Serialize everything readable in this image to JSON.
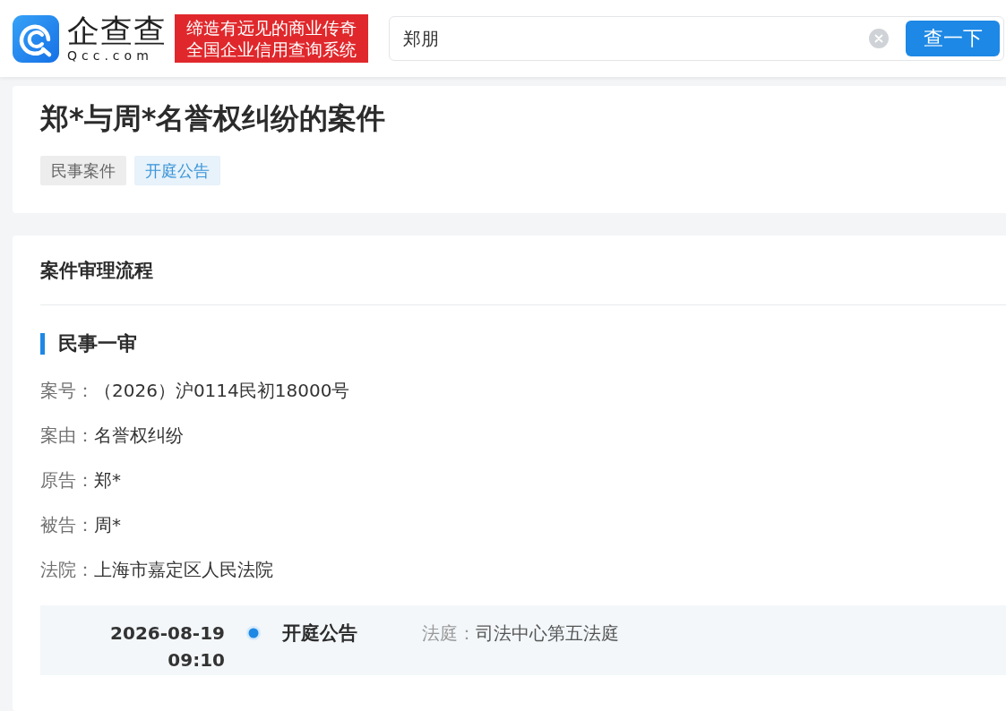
{
  "header": {
    "logo": {
      "name": "企查查",
      "domain": "Qcc.com"
    },
    "slogan": [
      "缔造有远见的商业传奇",
      "全国企业信用查询系统"
    ],
    "search": {
      "value": "郑朋",
      "button": "查一下"
    }
  },
  "case": {
    "title": "郑*与周*名誉权纠纷的案件",
    "tags": [
      {
        "label": "民事案件",
        "color": "#666666"
      },
      {
        "label": "开庭公告",
        "color": "#3a95d8"
      }
    ]
  },
  "process": {
    "title": "案件审理流程",
    "stages": [
      {
        "name": "民事一审",
        "fields": [
          {
            "label": "案号：",
            "value": "（2026）沪0114民初18000号"
          },
          {
            "label": "案由：",
            "value": "名誉权纠纷"
          },
          {
            "label": "原告：",
            "value": "郑*"
          },
          {
            "label": "被告：",
            "value": "周*"
          },
          {
            "label": "法院：",
            "value": "上海市嘉定区人民法院"
          }
        ],
        "events": [
          {
            "date": "2026-08-19",
            "time": "09:10",
            "title": "开庭公告",
            "details": [
              {
                "label": "法庭：",
                "value": "司法中心第五法庭"
              }
            ]
          }
        ]
      }
    ]
  }
}
